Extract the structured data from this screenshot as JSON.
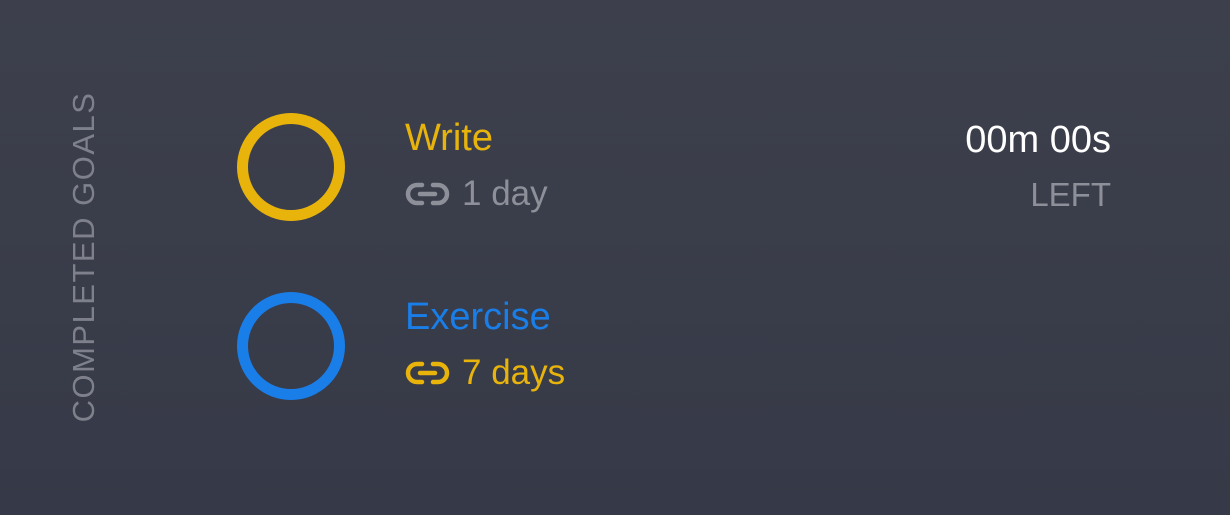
{
  "section": {
    "label": "COMPLETED GOALS"
  },
  "colors": {
    "background_top": "#3d404c",
    "background_bottom": "#363947",
    "write_accent": "#e8b40c",
    "exercise_accent": "#1a7ee8",
    "streak_muted": "#8d9099",
    "streak_active": "#e8b40c",
    "section_label": "#7e818b"
  },
  "goals": [
    {
      "title": "Write",
      "accent": "#e8b40c",
      "streak_icon": "link-icon",
      "streak": "1 day",
      "streak_color": "#8d9099",
      "timer": {
        "value": "00m 00s",
        "label": "LEFT"
      }
    },
    {
      "title": "Exercise",
      "accent": "#1a7ee8",
      "streak_icon": "link-icon",
      "streak": "7 days",
      "streak_color": "#e8b40c"
    }
  ]
}
